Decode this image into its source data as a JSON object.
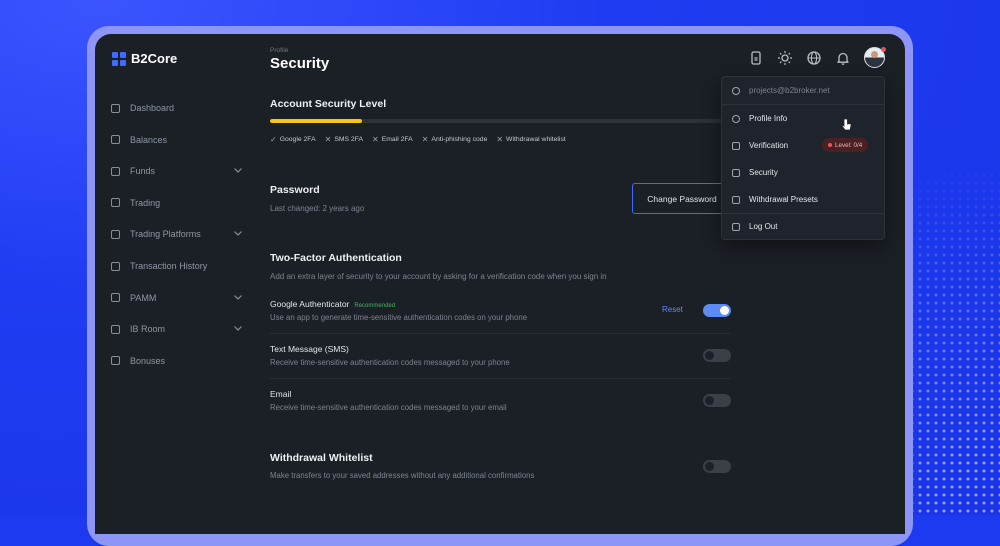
{
  "app": {
    "brand": "B2Core"
  },
  "sidebar": {
    "items": [
      {
        "label": "Dashboard",
        "has_chevron": false
      },
      {
        "label": "Balances",
        "has_chevron": false
      },
      {
        "label": "Funds",
        "has_chevron": true
      },
      {
        "label": "Trading",
        "has_chevron": false
      },
      {
        "label": "Trading Platforms",
        "has_chevron": true
      },
      {
        "label": "Transaction History",
        "has_chevron": false
      },
      {
        "label": "PAMM",
        "has_chevron": true
      },
      {
        "label": "IB Room",
        "has_chevron": true
      },
      {
        "label": "Bonuses",
        "has_chevron": false
      }
    ]
  },
  "header": {
    "breadcrumb": "Profile",
    "title": "Security",
    "icons": [
      "document-icon",
      "sun-icon",
      "globe-icon",
      "bell-icon",
      "avatar"
    ]
  },
  "security_level": {
    "title": "Account Security Level",
    "progress": 0.2,
    "checks": [
      "Google 2FA",
      "SMS 2FA",
      "Email 2FA",
      "Anti-phishing code",
      "Withdrawal whitelist"
    ],
    "check_states": [
      "done",
      "missing",
      "missing",
      "missing",
      "missing"
    ]
  },
  "password": {
    "title": "Password",
    "last_changed": "Last changed: 2 years ago",
    "button": "Change Password"
  },
  "two_factor": {
    "title": "Two-Factor Authentication",
    "description": "Add an extra layer of security to your account by asking for a verification code when you sign in",
    "google": {
      "title": "Google Authenticator",
      "badge": "Recommended",
      "description": "Use an app to generate time-sensitive authentication codes on your phone",
      "reset": "Reset",
      "enabled": true
    },
    "sms": {
      "title": "Text Message (SMS)",
      "description": "Receive time-sensitive authentication codes messaged to your phone",
      "enabled": false
    },
    "email": {
      "title": "Email",
      "description": "Receive time-sensitive authentication codes messaged to your email",
      "enabled": false
    }
  },
  "whitelist": {
    "title": "Withdrawal Whitelist",
    "description": "Make transfers to your saved addresses without any additional confirmations",
    "enabled": false
  },
  "user_menu": {
    "email": "projects@b2broker.net",
    "items": [
      "Profile Info",
      "Verification",
      "Security",
      "Withdrawal Presets",
      "Log Out"
    ],
    "verification_badge": "Level: 0/4"
  },
  "colors": {
    "accent": "#3d6bff",
    "progress": "#f5c518",
    "recommended": "#46b36a",
    "badge_bg": "#4a2024",
    "toggle_on": "#5b8cf5"
  }
}
